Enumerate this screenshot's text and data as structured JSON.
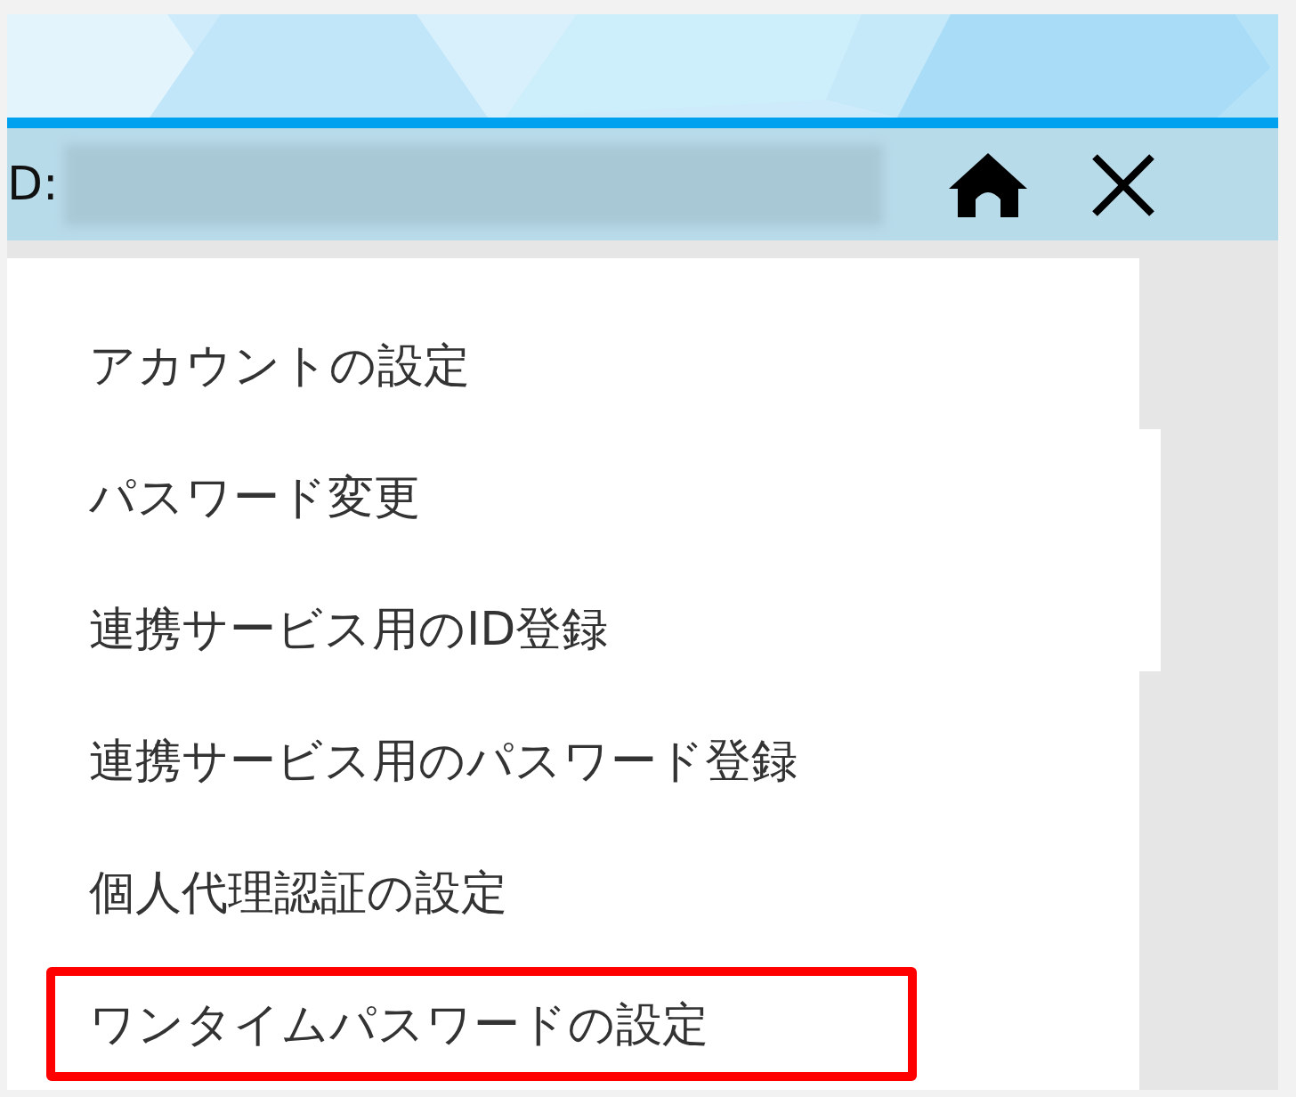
{
  "header": {
    "id_label": "D:"
  },
  "menu": {
    "items": [
      {
        "label": "アカウントの設定",
        "highlighted": false
      },
      {
        "label": "パスワード変更",
        "highlighted": false
      },
      {
        "label": "連携サービス用のID登録",
        "highlighted": false
      },
      {
        "label": "連携サービス用のパスワード登録",
        "highlighted": false
      },
      {
        "label": "個人代理認証の設定",
        "highlighted": false
      },
      {
        "label": "ワンタイムパスワードの設定",
        "highlighted": true
      }
    ]
  }
}
